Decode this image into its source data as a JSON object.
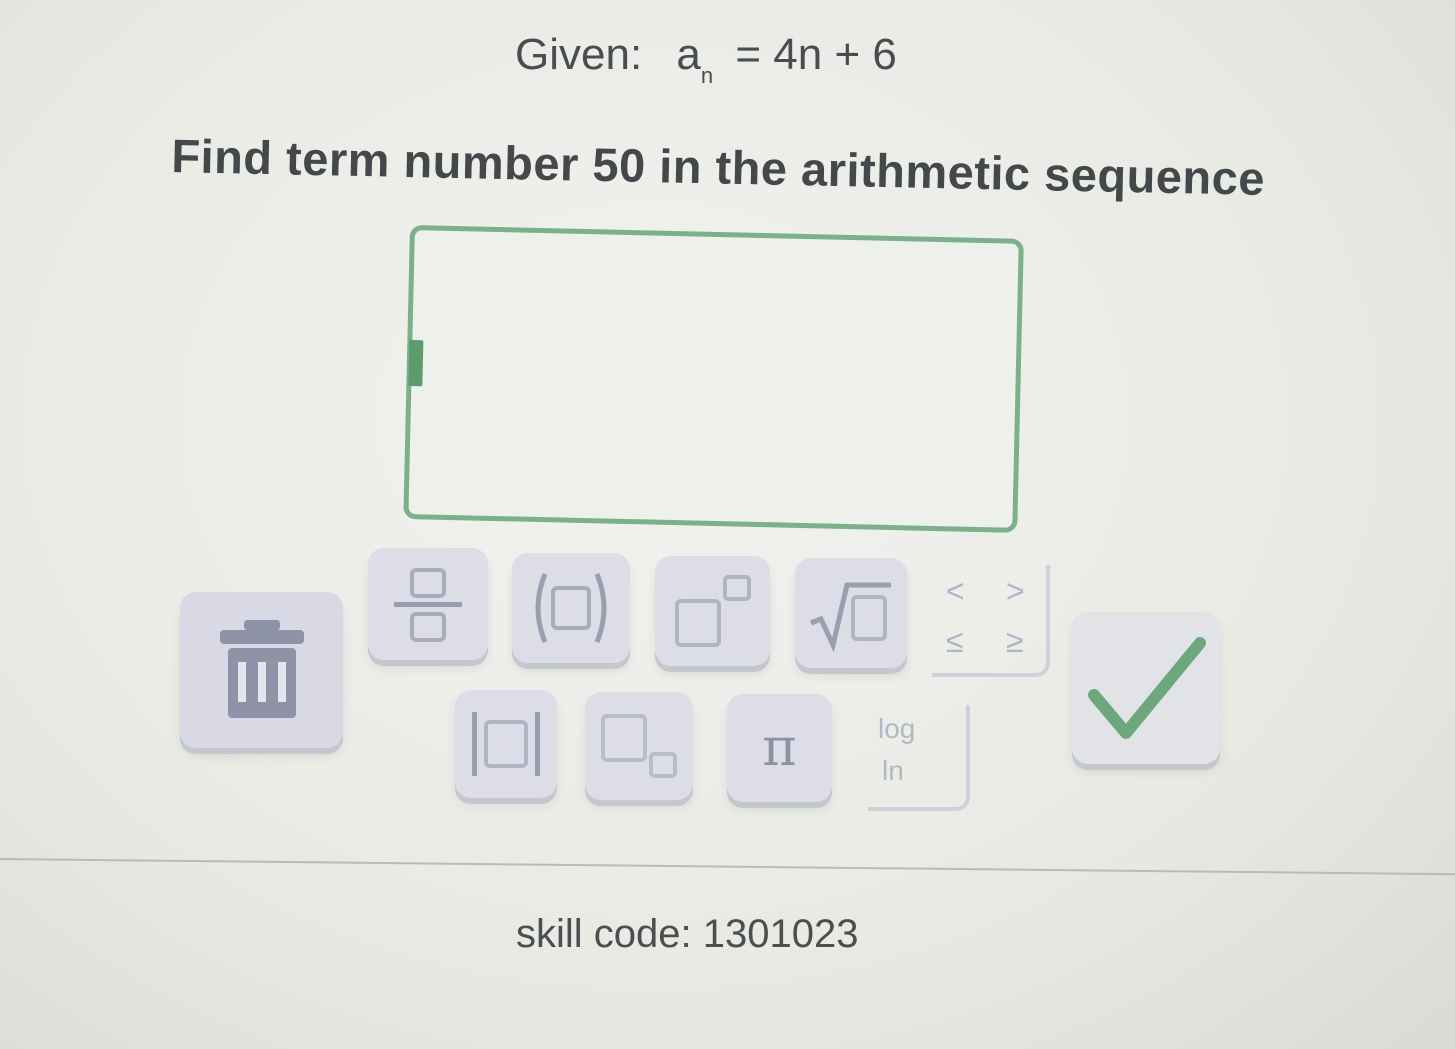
{
  "problem": {
    "given_label": "Given:",
    "var": "a",
    "sub": "n",
    "rhs": "= 4n + 6",
    "question": "Find term number 50 in the arithmetic sequence"
  },
  "answer": {
    "value": ""
  },
  "keypad": {
    "trash_icon": "trash-icon",
    "fraction_icon": "fraction-icon",
    "parentheses_label": "(□)",
    "exponent_icon": "exponent-icon",
    "sqrt_icon": "square-root-icon",
    "inequality_symbols": [
      "<",
      ">",
      "≤",
      "≥"
    ],
    "abs_icon": "absolute-value-icon",
    "subscript_icon": "subscript-icon",
    "pi_label": "π",
    "log_label": "log",
    "ln_label": "ln",
    "check_icon": "checkmark-icon"
  },
  "colors": {
    "accent": "#7cb08a",
    "check": "#6ea77c"
  },
  "footer": {
    "skill_code": "skill code: 1301023"
  }
}
